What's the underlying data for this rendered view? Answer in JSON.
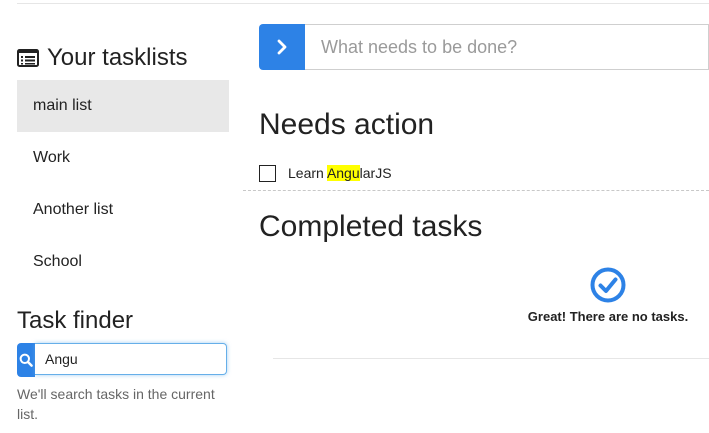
{
  "sidebar": {
    "title": "Your tasklists",
    "title_icon": "list-alt-icon",
    "items": [
      {
        "label": "main list",
        "active": true
      },
      {
        "label": "Work",
        "active": false
      },
      {
        "label": "Another list",
        "active": false
      },
      {
        "label": "School",
        "active": false
      }
    ]
  },
  "finder": {
    "title": "Task finder",
    "query": "Angu",
    "icon": "search-icon",
    "help": "We'll search tasks in the current list."
  },
  "new_task": {
    "placeholder": "What needs to be done?",
    "button_icon": "chevron-right-icon"
  },
  "needs_action": {
    "heading": "Needs action",
    "tasks": [
      {
        "text_highlight": "Angu",
        "text_before": "Learn ",
        "text_after": "larJS",
        "done": false
      }
    ]
  },
  "completed": {
    "heading": "Completed tasks",
    "empty_icon": "check-circle-icon",
    "empty_message": "Great! There are no tasks."
  },
  "colors": {
    "accent": "#2d82e6",
    "active_item_bg": "#e8e8e8",
    "highlight": "#ffff00"
  }
}
